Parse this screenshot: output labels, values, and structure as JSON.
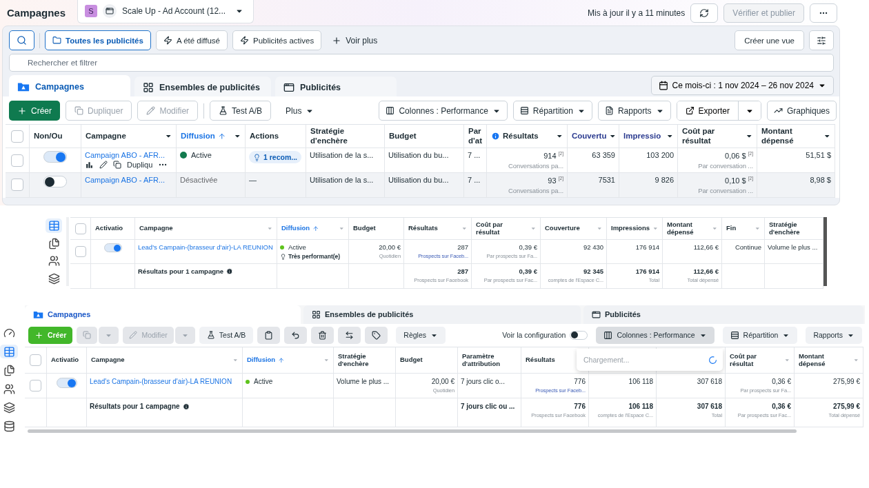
{
  "top_panel": {
    "header": {
      "title": "Campagnes",
      "account_badge": "S",
      "account": "Scale Up - Ad Account (12...",
      "updated": "Mis à jour il y a 11 minutes",
      "publish_button": {
        "label": "Vérifier et publier",
        "disabled": true
      }
    },
    "filters": [
      {
        "label": "Toutes les publicités",
        "selected": true
      },
      {
        "label": "A été diffusé",
        "selected": false
      },
      {
        "label": "Publicités actives",
        "selected": false
      }
    ],
    "more_filters": "Voir plus",
    "create_view": "Créer une vue",
    "search": {
      "placeholder": "Rechercher et filtrer"
    },
    "tabs": [
      {
        "label": "Campagnes",
        "selected": true
      },
      {
        "label": "Ensembles de publicités",
        "selected": false
      },
      {
        "label": "Publicités",
        "selected": false
      }
    ],
    "date_range": "Ce mois-ci : 1 nov 2024 – 26 nov 2024",
    "toolbar": {
      "create": "Créer",
      "actions": [
        {
          "kind": "button",
          "label": "Dupliquer",
          "disabled": true
        },
        {
          "kind": "button",
          "label": "Modifier",
          "disabled": true
        },
        {
          "kind": "separator"
        },
        {
          "kind": "button",
          "label": "Test A/B",
          "disabled": false
        },
        {
          "kind": "menu",
          "label": "Plus",
          "disabled": false
        }
      ],
      "right": [
        {
          "label": "Colonnes : Performance",
          "kind": "menu"
        },
        {
          "label": "Répartition",
          "kind": "menu"
        },
        {
          "label": "Rapports",
          "kind": "menu"
        },
        {
          "label": "Exporter",
          "kind": "split"
        },
        {
          "label": "Graphiques",
          "kind": "button"
        }
      ]
    },
    "table": {
      "columns": [
        {
          "kind": "check",
          "checked": false
        },
        {
          "kind": "label",
          "label": "Non/Ou",
          "menu": false,
          "sorted": false,
          "accent": false,
          "info": false
        },
        {
          "kind": "label",
          "label": "Campagne",
          "menu": true,
          "sorted": false,
          "accent": false,
          "info": false
        },
        {
          "kind": "label",
          "label": "Diffusion",
          "menu": true,
          "sorted": true,
          "accent": false,
          "info": false
        },
        {
          "kind": "label",
          "label": "Actions",
          "menu": false,
          "sorted": false,
          "accent": false,
          "info": false
        },
        {
          "kind": "label",
          "label": "Stratégie d'enchère",
          "menu": false,
          "sorted": false,
          "accent": false,
          "info": false
        },
        {
          "kind": "label",
          "label": "Budget",
          "menu": false,
          "sorted": false,
          "accent": false,
          "info": false
        },
        {
          "kind": "label",
          "label": "Par d'at",
          "sorted": false,
          "accent": false,
          "info": false
        },
        {
          "kind": "label",
          "label": "Résultats",
          "menu": true,
          "sorted": false,
          "accent": false,
          "info": true
        },
        {
          "kind": "label",
          "label": "Couvertu",
          "menu": true,
          "sorted": false,
          "accent": true,
          "info": false
        },
        {
          "kind": "label",
          "label": "Impressio",
          "menu": true,
          "sorted": false,
          "accent": true,
          "info": false
        },
        {
          "kind": "label",
          "label": "Coût par résultat",
          "menu": true,
          "sorted": false,
          "accent": false,
          "info": false
        },
        {
          "kind": "label",
          "label": "Montant dépensé",
          "menu": true,
          "sorted": false,
          "accent": false,
          "info": false
        }
      ],
      "rows": [
        {
          "hovered": false,
          "total": false,
          "cells": [
            {
              "kind": "check",
              "checked": false
            },
            {
              "kind": "toggle",
              "on": true
            },
            {
              "kind": "campaign",
              "text": "Campaign ABO - AFR...",
              "tools": "Dupliqu"
            },
            {
              "kind": "status",
              "text": "Active",
              "active": true
            },
            {
              "kind": "badge",
              "text": "1 recom..."
            },
            {
              "kind": "text",
              "text": "Utilisation de la s..."
            },
            {
              "kind": "text",
              "text": "Utilisation du bu..."
            },
            {
              "kind": "text",
              "text": "7 ..."
            },
            {
              "kind": "number",
              "text": "914 $^{[2]}$",
              "sub": "Conversations pa...",
              "sub_link": false
            },
            {
              "kind": "number",
              "text": "63 359"
            },
            {
              "kind": "number",
              "text": "103 200"
            },
            {
              "kind": "number",
              "text": "0,06 $ $^{[2]}$",
              "sub": "Par conversation ...",
              "sub_link": false
            },
            {
              "kind": "number",
              "text": "51,51 $"
            }
          ]
        },
        {
          "hovered": true,
          "total": false,
          "cells": [
            {
              "kind": "check",
              "checked": false
            },
            {
              "kind": "toggle",
              "on": false
            },
            {
              "kind": "campaign",
              "text": "Campaign ABO - AFR..."
            },
            {
              "kind": "status",
              "text": "Désactivée",
              "active": false
            },
            {
              "kind": "text",
              "text": "—"
            },
            {
              "kind": "text",
              "text": "Utilisation de la s..."
            },
            {
              "kind": "text",
              "text": "Utilisation du bu..."
            },
            {
              "kind": "text",
              "text": "7 ..."
            },
            {
              "kind": "number",
              "text": "93 $^{[2]}$",
              "sub": "Conversations pa...",
              "sub_link": false
            },
            {
              "kind": "number",
              "text": "7531"
            },
            {
              "kind": "number",
              "text": "9 826"
            },
            {
              "kind": "number",
              "text": "0,10 $ $^{[2]}$",
              "sub": "Par conversation ...",
              "sub_link": false
            },
            {
              "kind": "number",
              "text": "8,98 $"
            }
          ]
        }
      ]
    }
  },
  "middle_panel": {
    "sidebar": [
      {
        "selected": true
      },
      {
        "selected": false
      },
      {
        "selected": false
      },
      {
        "selected": false
      }
    ],
    "table": {
      "columns": [
        {
          "kind": "check",
          "checked": false
        },
        {
          "kind": "label",
          "label": "Activatio",
          "menu": false,
          "sorted": false,
          "accent": false,
          "info": false
        },
        {
          "kind": "label",
          "label": "Campagne",
          "menu": true,
          "sorted": false,
          "accent": false,
          "info": false
        },
        {
          "kind": "label",
          "label": "Diffusion",
          "menu": true,
          "sorted": true,
          "accent": false,
          "info": false
        },
        {
          "kind": "label",
          "label": "Budget",
          "menu": false,
          "sorted": false,
          "accent": false,
          "info": false
        },
        {
          "kind": "label",
          "label": "Résultats",
          "menu": true,
          "sorted": false,
          "accent": false,
          "info": false
        },
        {
          "kind": "label",
          "label": "Coût par résultat",
          "menu": true,
          "sorted": false,
          "accent": false,
          "info": false
        },
        {
          "kind": "label",
          "label": "Couverture",
          "menu": true,
          "sorted": false,
          "accent": false,
          "info": false
        },
        {
          "kind": "label",
          "label": "Impressions",
          "menu": true,
          "sorted": false,
          "accent": false,
          "info": false
        },
        {
          "kind": "label",
          "label": "Montant dépensé",
          "menu": true,
          "sorted": false,
          "accent": false,
          "info": false
        },
        {
          "kind": "label",
          "label": "Fin",
          "menu": true,
          "sorted": false,
          "accent": false,
          "info": false
        },
        {
          "kind": "label",
          "label": "Stratégie d'enchère",
          "menu": false,
          "sorted": false,
          "accent": false,
          "info": false
        }
      ],
      "rows": [
        {
          "hovered": false,
          "total": false,
          "cells": [
            {
              "kind": "check",
              "checked": false
            },
            {
              "kind": "toggle",
              "on": true
            },
            {
              "kind": "campaign",
              "text": "Lead's Campain-(brasseur d'air)-LA REUNION"
            },
            {
              "kind": "status",
              "text": "Active",
              "active": true,
              "note": "Très performant(e)"
            },
            {
              "kind": "number",
              "text": "20,00 €",
              "sub": "Quotidien",
              "sub_link": false
            },
            {
              "kind": "number",
              "text": "287",
              "sub": "Prospects sur Faceb...",
              "sub_link": true
            },
            {
              "kind": "number",
              "text": "0,39 €",
              "sub": "Par prospects sur Fa...",
              "sub_link": false
            },
            {
              "kind": "number",
              "text": "92 430"
            },
            {
              "kind": "number",
              "text": "176 914"
            },
            {
              "kind": "number",
              "text": "112,66 €"
            },
            {
              "kind": "number",
              "text": "Continue"
            },
            {
              "kind": "text",
              "text": "Volume le plus ..."
            }
          ]
        },
        {
          "hovered": false,
          "total": true,
          "cells": [
            {
              "kind": "blank"
            },
            {
              "kind": "blank"
            },
            {
              "kind": "total_label",
              "text": "Résultats pour 1 campagne"
            },
            {
              "kind": "blank"
            },
            {
              "kind": "blank"
            },
            {
              "kind": "number",
              "text": "287",
              "sub": "Prospects sur Facebook",
              "sub_link": false
            },
            {
              "kind": "number",
              "text": "0,39 €",
              "sub": "Par prospects sur Fac...",
              "sub_link": false
            },
            {
              "kind": "number",
              "text": "92 345",
              "sub": "comptes de l'Espace C...",
              "sub_link": false
            },
            {
              "kind": "number",
              "text": "176 914",
              "sub": "Total",
              "sub_link": false
            },
            {
              "kind": "number",
              "text": "112,66 €",
              "sub": "Total dépensé",
              "sub_link": false
            },
            {
              "kind": "blank"
            },
            {
              "kind": "blank"
            }
          ]
        }
      ]
    }
  },
  "bottom_panel": {
    "sidebar": [
      {
        "selected": false
      },
      {
        "selected": true
      },
      {
        "selected": false
      },
      {
        "selected": false
      },
      {
        "selected": false
      },
      {
        "selected": false
      }
    ],
    "tabs": [
      {
        "label": "Campagnes",
        "selected": true
      },
      {
        "label": "Ensembles de publicités",
        "selected": false
      },
      {
        "label": "Publicités",
        "selected": false
      }
    ],
    "toolbar": {
      "create": "Créer",
      "actions": [
        {
          "kind": "split",
          "disabled": true
        },
        {
          "kind": "split",
          "label": "Modifier",
          "disabled": true
        },
        {
          "kind": "button",
          "label": "Test A/B",
          "disabled": false
        },
        {
          "kind": "icon",
          "disabled": false
        },
        {
          "kind": "icon",
          "disabled": false
        },
        {
          "kind": "icon",
          "disabled": false
        },
        {
          "kind": "icon",
          "disabled": false
        },
        {
          "kind": "icon",
          "disabled": false
        },
        {
          "kind": "menu",
          "label": "Règles",
          "disabled": false
        }
      ],
      "config": {
        "label": "Voir la configuration",
        "on": false
      },
      "right": [
        {
          "label": "Colonnes : Performance",
          "pressed": true
        },
        {
          "label": "Répartition",
          "pressed": false
        },
        {
          "label": "Rapports",
          "pressed": false
        }
      ]
    },
    "column_search": {
      "placeholder": "Chargement..."
    },
    "table": {
      "columns": [
        {
          "kind": "check",
          "checked": false
        },
        {
          "kind": "label",
          "label": "Activatio",
          "menu": false,
          "sorted": false,
          "accent": false,
          "info": false
        },
        {
          "kind": "label",
          "label": "Campagne",
          "menu": true,
          "sorted": false,
          "accent": false,
          "info": false
        },
        {
          "kind": "label",
          "label": "Diffusion",
          "menu": true,
          "sorted": true,
          "accent": false,
          "info": false
        },
        {
          "kind": "label",
          "label": "Stratégie d'enchère",
          "menu": false,
          "sorted": false,
          "accent": false,
          "info": false
        },
        {
          "kind": "label",
          "label": "Budget",
          "menu": false,
          "sorted": false,
          "accent": false,
          "info": false
        },
        {
          "kind": "label",
          "label": "Paramètre d'attribution",
          "menu": false,
          "sorted": false,
          "accent": false,
          "info": false
        },
        {
          "kind": "label",
          "label": "Résultats",
          "sorted": false,
          "accent": false,
          "info": false
        },
        {
          "kind": "covered"
        },
        {
          "kind": "covered"
        },
        {
          "kind": "label",
          "label": "Coût par résultat",
          "menu": true,
          "sorted": false,
          "accent": false,
          "info": false
        },
        {
          "kind": "label",
          "label": "Montant dépensé",
          "menu": true,
          "sorted": false,
          "accent": false,
          "info": false
        }
      ],
      "rows": [
        {
          "hovered": false,
          "total": false,
          "cells": [
            {
              "kind": "check",
              "checked": false
            },
            {
              "kind": "toggle",
              "on": true
            },
            {
              "kind": "campaign",
              "text": "Lead's Campain-(brasseur d'air)-LA REUNION"
            },
            {
              "kind": "status",
              "text": "Active",
              "active": true
            },
            {
              "kind": "text",
              "text": "Volume le plus ..."
            },
            {
              "kind": "number",
              "text": "20,00 €",
              "sub": "Quotidien",
              "sub_link": false
            },
            {
              "kind": "text",
              "text": "7 jours clic o..."
            },
            {
              "kind": "number",
              "text": "776",
              "sub": "Prospects sur Faceb...",
              "sub_link": true
            },
            {
              "kind": "number",
              "text": "106 118"
            },
            {
              "kind": "number",
              "text": "307 618"
            },
            {
              "kind": "number",
              "text": "0,36 €",
              "sub": "Par prospects sur Fa...",
              "sub_link": false
            },
            {
              "kind": "number",
              "text": "275,99 €"
            }
          ]
        },
        {
          "hovered": false,
          "total": true,
          "cells": [
            {
              "kind": "blank"
            },
            {
              "kind": "blank"
            },
            {
              "kind": "total_label",
              "text": "Résultats pour 1 campagne"
            },
            {
              "kind": "blank"
            },
            {
              "kind": "blank"
            },
            {
              "kind": "blank"
            },
            {
              "kind": "text",
              "text": "7 jours clic ou ..."
            },
            {
              "kind": "number",
              "text": "776",
              "sub": "Prospects sur Facebook",
              "sub_link": false
            },
            {
              "kind": "number",
              "text": "106 118",
              "sub": "comptes de l'Espace C...",
              "sub_link": false
            },
            {
              "kind": "number",
              "text": "307 618",
              "sub": "Total",
              "sub_link": false
            },
            {
              "kind": "number",
              "text": "0,36 €",
              "sub": "Par prospects sur Fac...",
              "sub_link": false
            },
            {
              "kind": "number",
              "text": "275,99 €",
              "sub": "Total dépensé",
              "sub_link": false
            }
          ]
        }
      ]
    }
  }
}
